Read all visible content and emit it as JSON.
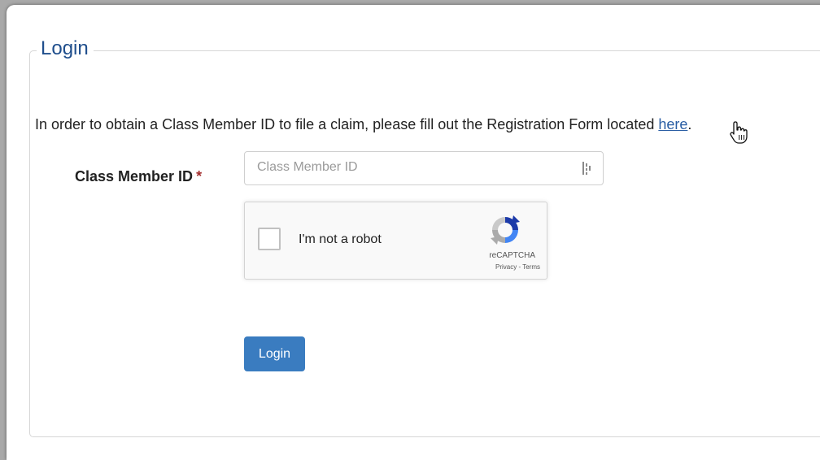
{
  "login": {
    "legend": "Login",
    "intro_text": "In order to obtain a Class Member ID to file a claim, please fill out the Registration Form located ",
    "intro_link": "here",
    "intro_end": ".",
    "field_label": "Class Member ID",
    "required_mark": "*",
    "field_placeholder": "Class Member ID",
    "field_value": "",
    "submit_label": "Login"
  },
  "recaptcha": {
    "label": "I'm not a robot",
    "brand": "reCAPTCHA",
    "privacy": "Privacy",
    "separator": " - ",
    "terms": "Terms"
  },
  "colors": {
    "legend": "#1f4e8c",
    "link": "#2a5ea4",
    "button": "#3a7cc0",
    "required": "#a32d2d"
  },
  "icons": {
    "password_manager": "password-manager-icon",
    "recaptcha_logo": "recaptcha-logo-icon",
    "cursor": "hand-pointer-icon"
  }
}
